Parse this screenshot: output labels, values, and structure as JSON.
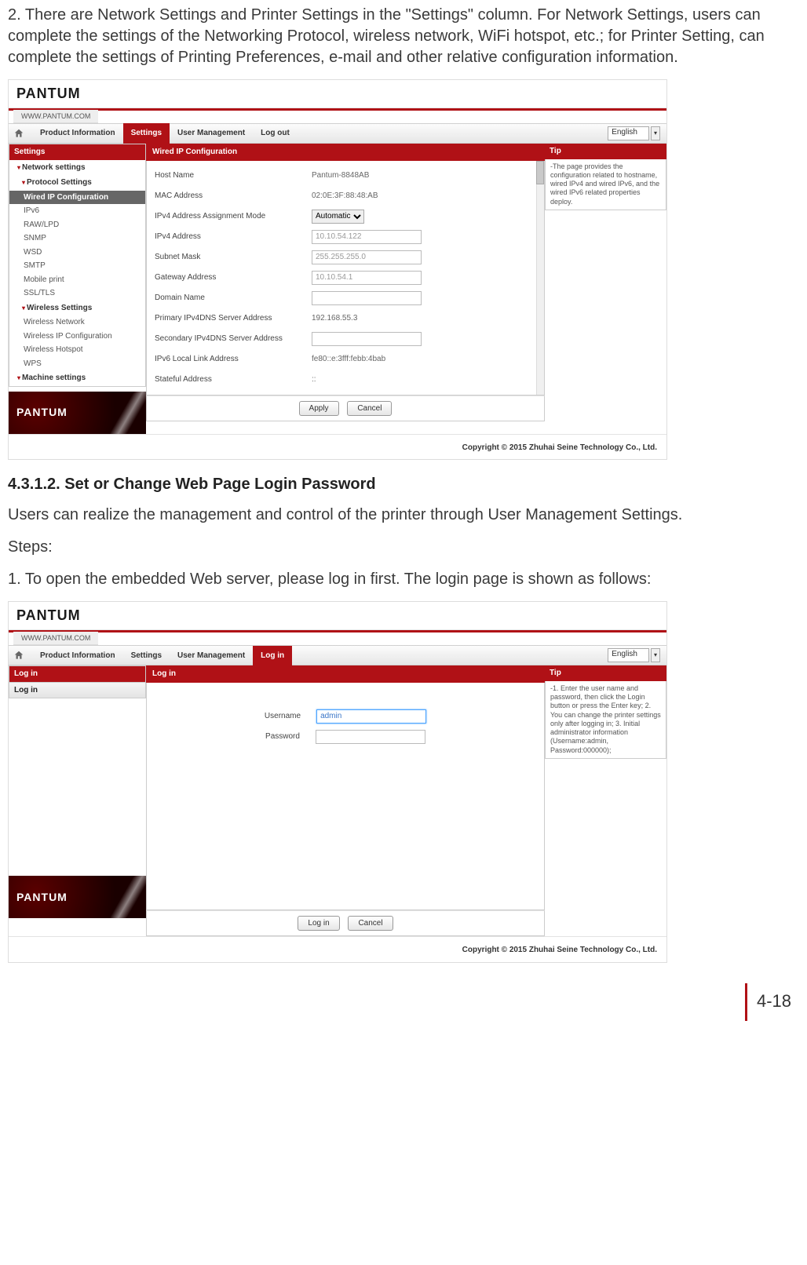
{
  "doc": {
    "para_intro": "2. There are Network Settings and Printer Settings in the \"Settings\" column.  For Network Settings, users can complete the settings of the Networking Protocol, wireless network, WiFi hotspot, etc.; for Printer Setting, can complete the settings of Printing Preferences, e-mail and other relative configuration information.",
    "heading_4312": "4.3.1.2. Set or Change Web Page Login Password",
    "para_um": "Users can realize the management and control of the printer through User Management Settings.",
    "steps_label": "Steps:",
    "step1": "1. To open the embedded Web server, please log in first. The login page is shown as follows:",
    "page_number": "4-18"
  },
  "common": {
    "brand": "PANTUM",
    "url": "WWW.PANTUM.COM",
    "lang": "English",
    "copyright": "Copyright © 2015 Zhuhai Seine Technology Co., Ltd."
  },
  "nav": {
    "product_info": "Product Information",
    "settings": "Settings",
    "user_mgmt": "User Management",
    "log_out": "Log out",
    "log_in": "Log in"
  },
  "shot1": {
    "left": {
      "settings": "Settings",
      "network_settings": "Network settings",
      "protocol_settings": "Protocol Settings",
      "items_protocol": {
        "wired_ip": "Wired IP Configuration",
        "ipv6": "IPv6",
        "rawlpd": "RAW/LPD",
        "snmp": "SNMP",
        "wsd": "WSD",
        "smtp": "SMTP",
        "mobile": "Mobile print",
        "ssl": "SSL/TLS"
      },
      "wireless_settings": "Wireless Settings",
      "items_wireless": {
        "wnet": "Wireless Network",
        "wipc": "Wireless IP Configuration",
        "whot": "Wireless Hotspot",
        "wps": "WPS"
      },
      "machine_settings": "Machine settings"
    },
    "center": {
      "panel_title": "Wired IP Configuration",
      "rows": {
        "host_name_l": "Host Name",
        "host_name_v": "Pantum-8848AB",
        "mac_l": "MAC Address",
        "mac_v": "02:0E:3F:88:48:AB",
        "ipv4_assign_l": "IPv4 Address Assignment Mode",
        "ipv4_assign_v": "Automatic",
        "ipv4_addr_l": "IPv4 Address",
        "ipv4_addr_v": "10.10.54.122",
        "subnet_l": "Subnet Mask",
        "subnet_v": "255.255.255.0",
        "gateway_l": "Gateway Address",
        "gateway_v": "10.10.54.1",
        "domain_l": "Domain Name",
        "domain_v": "",
        "pdns_l": "Primary IPv4DNS Server Address",
        "pdns_v": "192.168.55.3",
        "sdns_l": "Secondary IPv4DNS Server Address",
        "sdns_v": "",
        "ipv6ll_l": "IPv6 Local Link Address",
        "ipv6ll_v": "fe80::e:3fff:febb:4bab",
        "stateful_l": "Stateful Address",
        "stateful_v": "::"
      },
      "apply": "Apply",
      "cancel": "Cancel"
    },
    "tip": {
      "title": "Tip",
      "body": "-The page provides the configuration related to hostname, wired IPv4 and wired IPv6, and the wired IPv6 related properties deploy."
    }
  },
  "shot2": {
    "left": {
      "login_hdr": "Log in",
      "login_item": "Log in"
    },
    "center": {
      "panel_title": "Log in",
      "username_l": "Username",
      "username_v": "admin",
      "password_l": "Password",
      "login_btn": "Log in",
      "cancel_btn": "Cancel"
    },
    "tip": {
      "title": "Tip",
      "body": "-1. Enter the user name and password, then click the Login button or press the Enter key; 2. You can change the printer settings only after logging in; 3. Initial administrator information (Username:admin, Password:000000);"
    }
  }
}
